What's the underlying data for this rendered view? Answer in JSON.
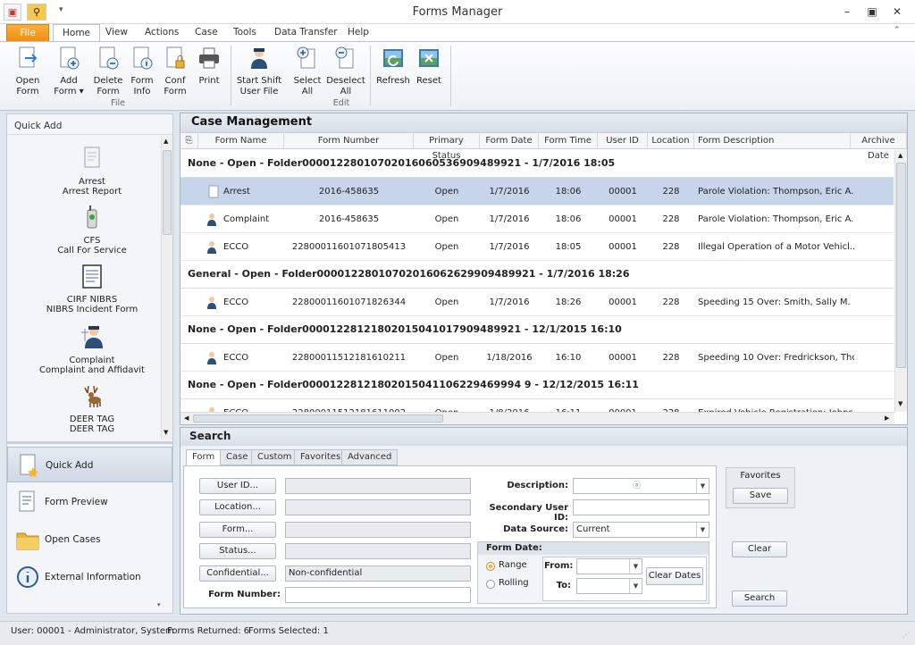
{
  "window": {
    "title": "Forms Manager"
  },
  "ribbon_tabs": [
    "File",
    "Home",
    "View",
    "Actions",
    "Case",
    "Tools",
    "Data Transfer",
    "Help"
  ],
  "ribbon": {
    "file_group": "File",
    "edit_group": "Edit",
    "open_form": [
      "Open",
      "Form"
    ],
    "add_form": [
      "Add",
      "Form ▾"
    ],
    "delete_form": [
      "Delete",
      "Form"
    ],
    "form_info": [
      "Form",
      "Info"
    ],
    "conf_form": [
      "Conf",
      "Form"
    ],
    "print": [
      "Print",
      ""
    ],
    "start_shift": [
      "Start Shift",
      "User File"
    ],
    "select_all": [
      "Select",
      "All"
    ],
    "deselect_all": [
      "Deselect",
      "All"
    ],
    "refresh": [
      "Refresh",
      ""
    ],
    "reset": [
      "Reset",
      ""
    ]
  },
  "left": {
    "header": "Quick Add",
    "items": [
      {
        "l1": "Arrest",
        "l2": "Arrest Report",
        "icon": "arrest-report-icon"
      },
      {
        "l1": "CFS",
        "l2": "Call For Service",
        "icon": "radio-icon"
      },
      {
        "l1": "CIRF NIBRS",
        "l2": "NIBRS Incident Form",
        "icon": "clipboard-icon"
      },
      {
        "l1": "Complaint",
        "l2": "Complaint and Affidavit",
        "icon": "complaint-icon"
      },
      {
        "l1": "DEER TAG",
        "l2": "DEER TAG",
        "icon": "deer-icon"
      }
    ],
    "nav": [
      "Quick Add",
      "Form Preview",
      "Open Cases",
      "External Information"
    ]
  },
  "case_management": {
    "title": "Case Management",
    "columns": [
      "Form Name",
      "Form Number",
      "Primary Status",
      "Form Date",
      "Form Time",
      "User ID",
      "Location",
      "Form Description",
      "Archive Date"
    ],
    "groups": [
      {
        "header": "None  -  Open  -  Folder00001228010702016060536909489921  -  1/7/2016 18:05",
        "rows": [
          {
            "name": "Arrest",
            "number": "2016-458635",
            "status": "Open",
            "date": "1/7/2016",
            "time": "18:06",
            "user": "00001",
            "loc": "228",
            "desc": "Parole Violation: Thompson, Eric A.",
            "selected": true
          },
          {
            "name": "Complaint",
            "number": "2016-458635",
            "status": "Open",
            "date": "1/7/2016",
            "time": "18:06",
            "user": "00001",
            "loc": "228",
            "desc": "Parole Violation: Thompson, Eric A.",
            "selected": false
          },
          {
            "name": "ECCO",
            "number": "22800011601071805413",
            "status": "Open",
            "date": "1/7/2016",
            "time": "18:05",
            "user": "00001",
            "loc": "228",
            "desc": "Illegal Operation of a Motor Vehicl...",
            "selected": false
          }
        ]
      },
      {
        "header": "General  -  Open  -  Folder00001228010702016062629909489921  -  1/7/2016 18:26",
        "rows": [
          {
            "name": "ECCO",
            "number": "22800011601071826344",
            "status": "Open",
            "date": "1/7/2016",
            "time": "18:26",
            "user": "00001",
            "loc": "228",
            "desc": "Speeding 15 Over: Smith, Sally M.",
            "selected": false
          }
        ]
      },
      {
        "header": "None  -  Open  -  Folder00001228121802015041017909489921  -  12/1/2015 16:10",
        "rows": [
          {
            "name": "ECCO",
            "number": "22800011512181610211",
            "status": "Open",
            "date": "1/18/2016",
            "time": "16:10",
            "user": "00001",
            "loc": "228",
            "desc": "Speeding 10 Over: Fredrickson, Tho...",
            "selected": false
          }
        ]
      },
      {
        "header": "None  -  Open  -  Folder00001228121802015041106229469994 9  -  12/12/2015 16:11",
        "rows": [
          {
            "name": "ECCO",
            "number": "22800011512181611092",
            "status": "Open",
            "date": "1/8/2016",
            "time": "16:11",
            "user": "00001",
            "loc": "228",
            "desc": "Expired Vehicle Registration: Johns...",
            "selected": false
          }
        ]
      }
    ]
  },
  "search": {
    "title": "Search",
    "tabs": [
      "Form",
      "Case",
      "Custom",
      "Favorites",
      "Advanced"
    ],
    "user_id_btn": "User ID...",
    "location_btn": "Location...",
    "form_btn": "Form...",
    "status_btn": "Status...",
    "confidential_btn": "Confidential...",
    "confidential_value": "Non-confidential",
    "form_number_label": "Form Number:",
    "description_label": "Description:",
    "secondary_user_label": "Secondary User ID:",
    "data_source_label": "Data Source:",
    "data_source_value": "Current",
    "form_date_label": "Form Date:",
    "range": "Range",
    "rolling": "Rolling",
    "from": "From:",
    "to": "To:",
    "clear_dates": "Clear Dates",
    "favorites_label": "Favorites",
    "save": "Save",
    "clear": "Clear",
    "search": "Search"
  },
  "status": {
    "user": "User: 00001 - Administrator, System",
    "returned": "Forms Returned: 6",
    "selected": "Forms Selected: 1"
  }
}
